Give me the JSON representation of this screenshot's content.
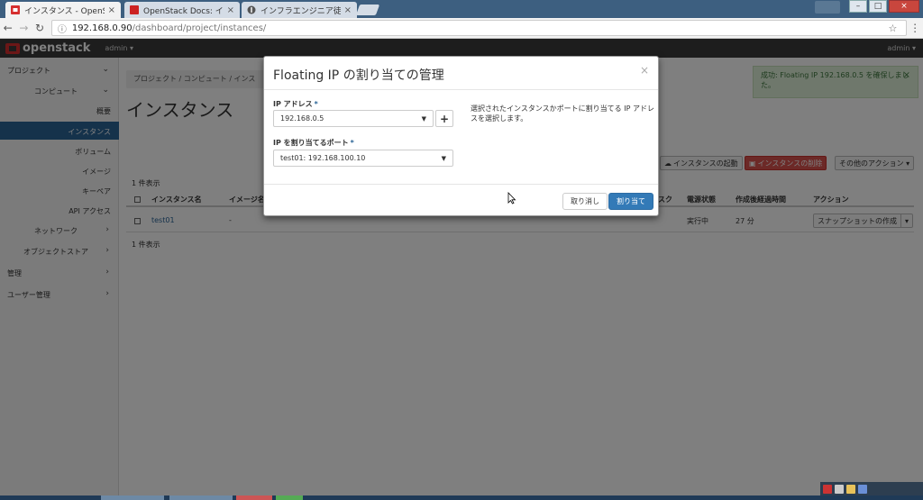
{
  "browser": {
    "tabs": [
      {
        "title": "インスタンス - OpenSt",
        "active": true
      },
      {
        "title": "OpenStack Docs: イメ",
        "active": false
      },
      {
        "title": "インフラエンジニア徒然",
        "active": false
      }
    ],
    "url_host": "192.168.0.90",
    "url_path": "/dashboard/project/instances/"
  },
  "topnav": {
    "logo": "openstack",
    "project": "admin ▾",
    "user": "admin ▾"
  },
  "sidebar": {
    "project": "プロジェクト",
    "compute": "コンピュート",
    "items": [
      "概要",
      "インスタンス",
      "ボリューム",
      "イメージ",
      "キーペア",
      "API アクセス"
    ],
    "network": "ネットワーク",
    "object_store": "オブジェクトストア",
    "admin": "管理",
    "identity": "ユーザー管理"
  },
  "main": {
    "breadcrumb": "プロジェクト / コンピュート / インス",
    "title": "インスタンス",
    "launch_btn": "インスタンスの起動",
    "delete_btn": "インスタンスの削除",
    "more_btn": "その他のアクション ▾",
    "count": "1 件表示",
    "columns": {
      "name": "インスタンス名",
      "image": "イメージ名",
      "disk": "スク",
      "power": "電源状態",
      "age": "作成後経過時間",
      "actions": "アクション"
    },
    "row": {
      "name": "test01",
      "image": "-",
      "power": "実行中",
      "age": "27 分",
      "action": "スナップショットの作成"
    },
    "count_bottom": "1 件表示"
  },
  "alert": {
    "text": "成功: Floating IP 192.168.0.5 を確保しました。",
    "close": "×"
  },
  "modal": {
    "title": "Floating IP の割り当ての管理",
    "close": "×",
    "ip_label": "IP アドレス",
    "ip_value": "192.168.0.5",
    "port_label": "IP を割り当てるポート",
    "port_value": "test01: 192.168.100.10",
    "required_mark": "*",
    "help": "選択されたインスタンスかポートに割り当てる IP アドレスを選択します。",
    "cancel": "取り消し",
    "submit": "割り当て"
  },
  "colors": {
    "primary": "#337ab7",
    "danger": "#d9534f",
    "success_bg": "#dff0d8",
    "nav_dark": "#3a3a3a"
  }
}
